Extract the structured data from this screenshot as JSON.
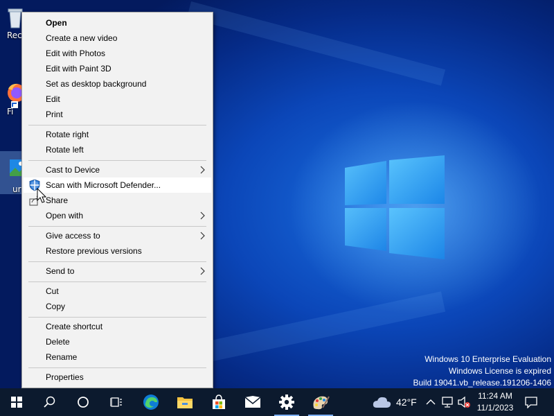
{
  "desktop": {
    "icons": [
      {
        "label": "Recy",
        "icon": "recycle-bin-icon"
      },
      {
        "label": "Fi",
        "icon": "firefox-icon"
      },
      {
        "label": "ur",
        "icon": "image-file-icon"
      }
    ],
    "watermark": {
      "line1": "Windows 10 Enterprise Evaluation",
      "line2": "Windows License is expired",
      "line3": "Build 19041.vb_release.191206-1406"
    }
  },
  "context_menu": {
    "items": [
      {
        "label": "Open",
        "bold": true
      },
      {
        "label": "Create a new video"
      },
      {
        "label": "Edit with Photos"
      },
      {
        "label": "Edit with Paint 3D"
      },
      {
        "label": "Set as desktop background"
      },
      {
        "label": "Edit"
      },
      {
        "label": "Print"
      },
      {
        "label": "Rotate right"
      },
      {
        "label": "Rotate left"
      },
      {
        "label": "Cast to Device",
        "submenu": true
      },
      {
        "label": "Scan with Microsoft Defender...",
        "icon": "defender-shield-icon",
        "highlighted": true
      },
      {
        "label": "Share",
        "icon": "share-icon"
      },
      {
        "label": "Open with",
        "submenu": true
      },
      {
        "label": "Give access to",
        "submenu": true
      },
      {
        "label": "Restore previous versions"
      },
      {
        "label": "Send to",
        "submenu": true
      },
      {
        "label": "Cut"
      },
      {
        "label": "Copy"
      },
      {
        "label": "Create shortcut"
      },
      {
        "label": "Delete"
      },
      {
        "label": "Rename"
      },
      {
        "label": "Properties"
      }
    ]
  },
  "taskbar": {
    "buttons": [
      "start-icon",
      "search-icon",
      "cortana-icon",
      "task-view-icon",
      "edge-icon",
      "file-explorer-icon",
      "store-icon",
      "mail-icon",
      "settings-icon",
      "paint-icon"
    ],
    "weather": {
      "temp": "42°F",
      "icon": "cloud-icon"
    },
    "clock": {
      "time": "11:24 AM",
      "date": "11/1/2023"
    },
    "colors": {
      "taskbar_bg": "#0c1a2e",
      "accent": "#7fb2ff"
    }
  }
}
